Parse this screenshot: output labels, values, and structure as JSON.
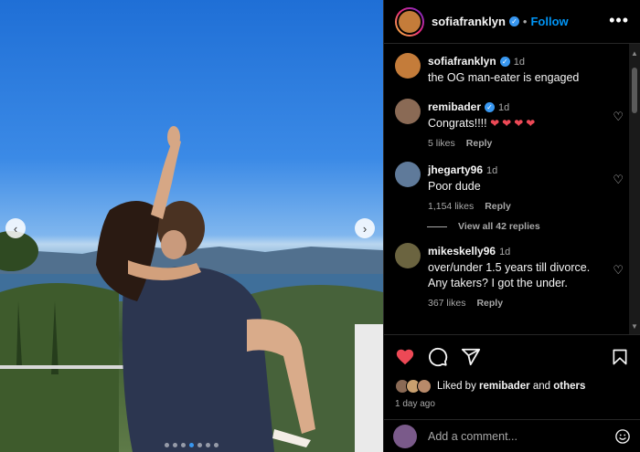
{
  "post": {
    "username": "sofiafranklyn",
    "follow_label": "Follow",
    "separator": "•",
    "more_label": "•••",
    "carousel_count": 7,
    "carousel_active_index": 3
  },
  "comments": [
    {
      "username": "sofiafranklyn",
      "verified": true,
      "time": "1d",
      "text": "the OG man-eater is engaged",
      "likes": "",
      "reply": "",
      "avatar_color": "#c47c3a"
    },
    {
      "username": "remibader",
      "verified": true,
      "time": "1d",
      "text": "Congrats!!!!",
      "hearts": "❤❤❤❤",
      "likes": "5 likes",
      "reply": "Reply",
      "avatar_color": "#8a6a55"
    },
    {
      "username": "jhegarty96",
      "verified": false,
      "time": "1d",
      "text": "Poor dude",
      "likes": "1,154 likes",
      "reply": "Reply",
      "avatar_color": "#5f7a9a"
    },
    {
      "username": "mikeskelly96",
      "verified": false,
      "time": "1d",
      "text": "over/under 1.5 years till divorce. Any takers? I got the under.",
      "likes": "367 likes",
      "reply": "Reply",
      "avatar_color": "#6b6440"
    }
  ],
  "view_replies": "View all 42 replies",
  "liked_by": {
    "prefix": "Liked by",
    "user": "remibader",
    "and": "and",
    "others": "others"
  },
  "posted_time": "1 day ago",
  "add_comment": {
    "placeholder": "Add a comment..."
  },
  "icons": {
    "like": "heart-filled-icon",
    "comment": "comment-icon",
    "share": "share-icon",
    "save": "bookmark-icon",
    "emoji": "smiley-icon",
    "verified": "verified-badge-icon"
  },
  "colors": {
    "accent": "#0095f6",
    "like_red": "#ed4956",
    "background": "#000000"
  }
}
